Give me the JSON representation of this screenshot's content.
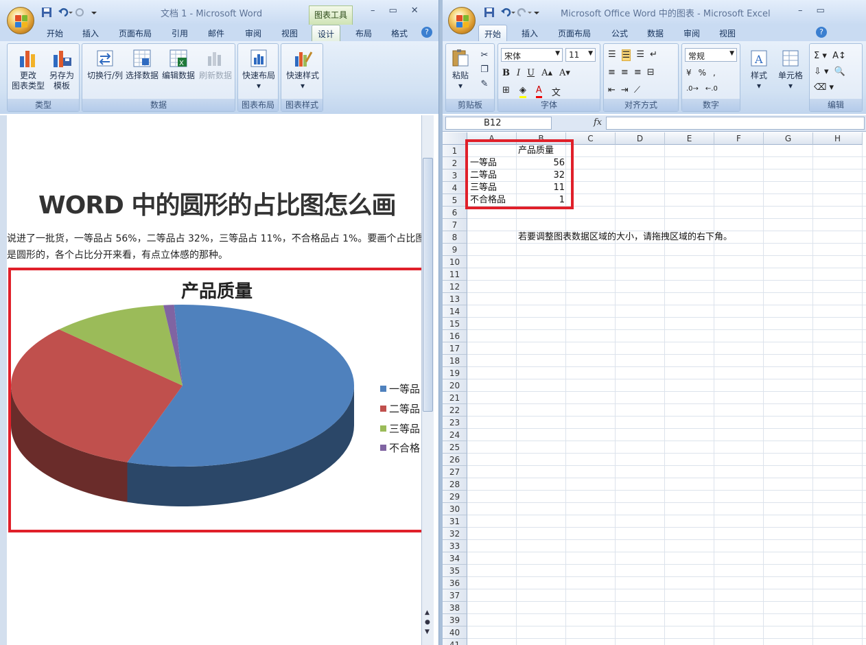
{
  "word": {
    "title": "文档 1 - Microsoft Word",
    "context_tab": "图表工具",
    "tabs": [
      "开始",
      "插入",
      "页面布局",
      "引用",
      "邮件",
      "审阅",
      "视图",
      "设计",
      "布局",
      "格式"
    ],
    "selected_tab": "设计",
    "groups": {
      "type": "类型",
      "data": "数据",
      "layout": "图表布局",
      "style": "图表样式"
    },
    "buttons": {
      "change_type_1": "更改",
      "change_type_2": "图表类型",
      "save_template_1": "另存为",
      "save_template_2": "模板",
      "switch_row_col": "切换行/列",
      "select_data": "选择数据",
      "edit_data": "编辑数据",
      "refresh_data": "刷新数据",
      "quick_layout": "快速布局",
      "quick_style": "快速样式"
    },
    "document": {
      "heading": "WORD 中的圆形的占比图怎么画",
      "para1": "说进了一批货，一等品占 56%，二等品占 32%，三等品占 11%，不合格品占 1%。要画个占比图",
      "para2": "是圆形的，各个占比分开来看，有点立体感的那种。"
    }
  },
  "chart_data": {
    "type": "pie",
    "title": "产品质量",
    "categories": [
      "一等品",
      "二等品",
      "三等品",
      "不合格品"
    ],
    "legend_labels": [
      "一等品",
      "二等品",
      "三等品",
      "不合格"
    ],
    "values": [
      56,
      32,
      11,
      1
    ],
    "colors": [
      "#4f81bd",
      "#c0504d",
      "#9bbb59",
      "#8064a2"
    ],
    "legend_position": "right"
  },
  "excel": {
    "title": "Microsoft Office Word 中的图表 - Microsoft Excel",
    "tabs": [
      "开始",
      "插入",
      "页面布局",
      "公式",
      "数据",
      "审阅",
      "视图"
    ],
    "selected_tab": "开始",
    "font_name": "宋体",
    "font_size": "11",
    "number_format": "常规",
    "groups": {
      "clipboard": "剪贴板",
      "font": "字体",
      "align": "对齐方式",
      "number": "数字",
      "edit": "编辑"
    },
    "buttons": {
      "paste": "粘贴",
      "styles": "样式",
      "cells": "单元格"
    },
    "name_box": "B12",
    "fx": "fx",
    "columns": [
      "A",
      "B",
      "C",
      "D",
      "E",
      "F",
      "G",
      "H"
    ],
    "rows": [
      "1",
      "2",
      "3",
      "4",
      "5",
      "6",
      "7",
      "8",
      "9",
      "10",
      "11",
      "12",
      "13",
      "14",
      "15",
      "16",
      "17",
      "18",
      "19",
      "20",
      "21",
      "22",
      "23",
      "24",
      "25",
      "26",
      "27",
      "28",
      "29",
      "30",
      "31",
      "32",
      "33",
      "34",
      "35",
      "36",
      "37",
      "38",
      "39",
      "40",
      "41"
    ],
    "cells": {
      "b1": "产品质量",
      "a2": "一等品",
      "b2": "56",
      "a3": "二等品",
      "b3": "32",
      "a4": "三等品",
      "b4": "11",
      "a5": "不合格品",
      "b5": "1",
      "b8": "若要调整图表数据区域的大小，请拖拽区域的右下角。"
    }
  }
}
